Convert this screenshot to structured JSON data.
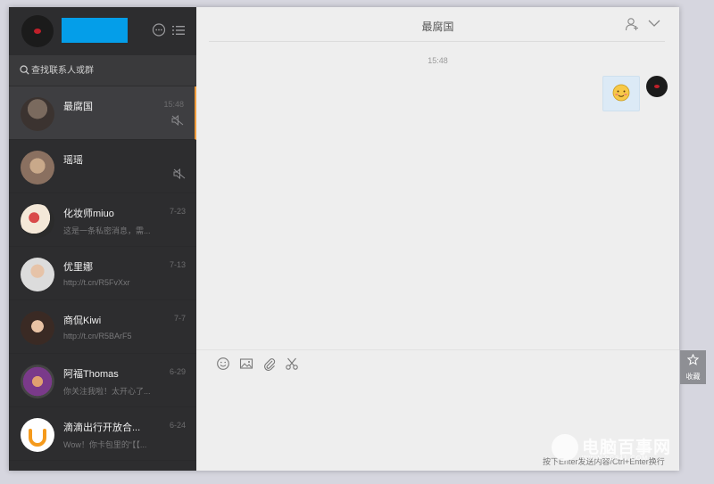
{
  "search": {
    "placeholder": "查找联系人或群"
  },
  "chat": {
    "title": "最腐国",
    "timestamp": "15:48"
  },
  "message": {
    "emoji": "emoji-smile-blush"
  },
  "composer": {
    "hint": "按下Enter发送内容/Ctrl+Enter换行"
  },
  "favorite": {
    "label": "收藏"
  },
  "contacts": [
    {
      "name": "最腐国",
      "time": "15:48",
      "preview": "",
      "muted": true,
      "active": true
    },
    {
      "name": "瑶瑶",
      "time": "",
      "preview": "",
      "muted": true,
      "active": false
    },
    {
      "name": "化妆师miuo",
      "time": "7-23",
      "preview": "这是一条私密消息，需...",
      "muted": false,
      "active": false
    },
    {
      "name": "优里娜",
      "time": "7-13",
      "preview": "http://t.cn/R5FvXxr",
      "muted": false,
      "active": false
    },
    {
      "name": "商侃Kiwi",
      "time": "7-7",
      "preview": "http://t.cn/R5BArF5",
      "muted": false,
      "active": false
    },
    {
      "name": "阿福Thomas",
      "time": "6-29",
      "preview": "你关注我啦！太开心了...",
      "muted": false,
      "active": false
    },
    {
      "name": "滴滴出行开放合...",
      "time": "6-24",
      "preview": "Wow！你卡包里的“【【...",
      "muted": false,
      "active": false
    }
  ],
  "watermark": {
    "title": "电脑百事网",
    "sub": "WWW.PC841.COM"
  },
  "colors": {
    "sidebar": "#2d2d2f",
    "accent": "#ef9b3c",
    "name_block": "#049ee9",
    "bubble": "#dceaf6"
  }
}
